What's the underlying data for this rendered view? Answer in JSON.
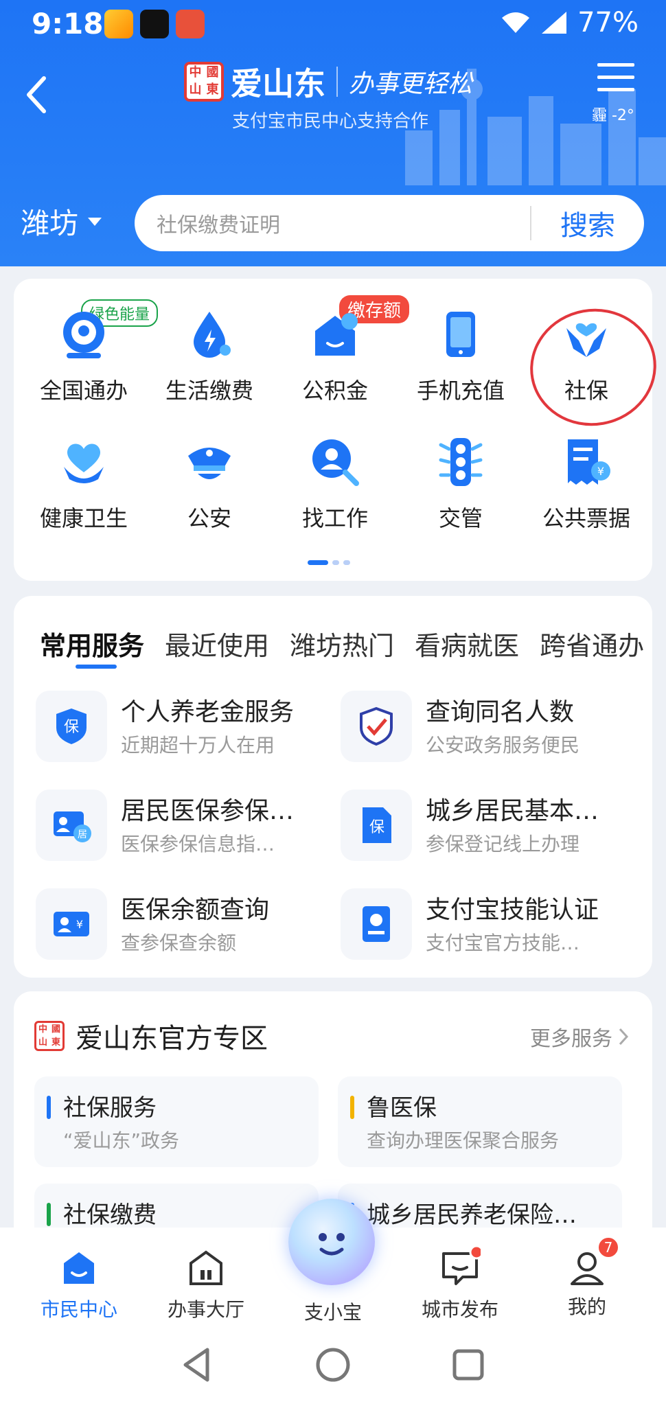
{
  "status": {
    "time": "9:18",
    "battery": "77%"
  },
  "header": {
    "brand": "爱山东",
    "seal": [
      "中",
      "國",
      "山",
      "東"
    ],
    "slogan": "办事更轻松",
    "subtitle": "支付宝市民中心支持合作",
    "weather": "霾 -2°"
  },
  "city": {
    "name": "潍坊"
  },
  "search": {
    "placeholder": "社保缴费证明",
    "button": "搜索"
  },
  "grid": [
    {
      "label": "全国通办",
      "badge": "绿色能量",
      "icon": "globe-person-icon"
    },
    {
      "label": "生活缴费",
      "icon": "water-drop-bolt-icon"
    },
    {
      "label": "公积金",
      "badge": "缴存额",
      "icon": "fund-house-icon"
    },
    {
      "label": "手机充值",
      "icon": "phone-icon"
    },
    {
      "label": "社保",
      "icon": "hands-heart-icon"
    },
    {
      "label": "健康卫生",
      "icon": "heart-hands-icon"
    },
    {
      "label": "公安",
      "icon": "police-cap-icon"
    },
    {
      "label": "找工作",
      "icon": "person-search-icon"
    },
    {
      "label": "交管",
      "icon": "traffic-light-icon"
    },
    {
      "label": "公共票据",
      "icon": "receipt-icon"
    }
  ],
  "tabs": [
    "常用服务",
    "最近使用",
    "潍坊热门",
    "看病就医",
    "跨省通办"
  ],
  "services": [
    {
      "title": "个人养老金服务",
      "sub": "近期超十万人在用",
      "icon": "pension-shield-icon"
    },
    {
      "title": "查询同名人数",
      "sub": "公安政务服务便民",
      "icon": "police-badge-icon"
    },
    {
      "title": "居民医保参保…",
      "sub": "医保参保信息指…",
      "icon": "resident-card-icon"
    },
    {
      "title": "城乡居民基本…",
      "sub": "参保登记线上办理",
      "icon": "insurance-doc-icon"
    },
    {
      "title": "医保余额查询",
      "sub": "查参保查余额",
      "icon": "medical-card-icon"
    },
    {
      "title": "支付宝技能认证",
      "sub": "支付宝官方技能…",
      "icon": "certificate-icon"
    }
  ],
  "zone": {
    "title": "爱山东官方专区",
    "more": "更多服务",
    "items": [
      {
        "title": "社保服务",
        "sub": "“爱山东”政务",
        "color": "#1e74f5"
      },
      {
        "title": "鲁医保",
        "sub": "查询办理医保聚合服务",
        "color": "#f2b300"
      },
      {
        "title": "社保缴费",
        "sub": "",
        "color": "#1aa34a"
      },
      {
        "title": "城乡居民养老保险…",
        "sub": "",
        "color": "#1e74f5"
      }
    ]
  },
  "tabbar": [
    {
      "label": "市民中心",
      "icon": "citizen-center-icon"
    },
    {
      "label": "办事大厅",
      "icon": "service-hall-icon"
    },
    {
      "label": "支小宝",
      "icon": "assistant-icon"
    },
    {
      "label": "城市发布",
      "icon": "city-news-icon"
    },
    {
      "label": "我的",
      "icon": "profile-icon",
      "count": "7"
    }
  ],
  "colors": {
    "primary": "#1e74f5",
    "header": "#2a82f7",
    "badge_red": "#f24a3d",
    "badge_green": "#1aa34a"
  }
}
